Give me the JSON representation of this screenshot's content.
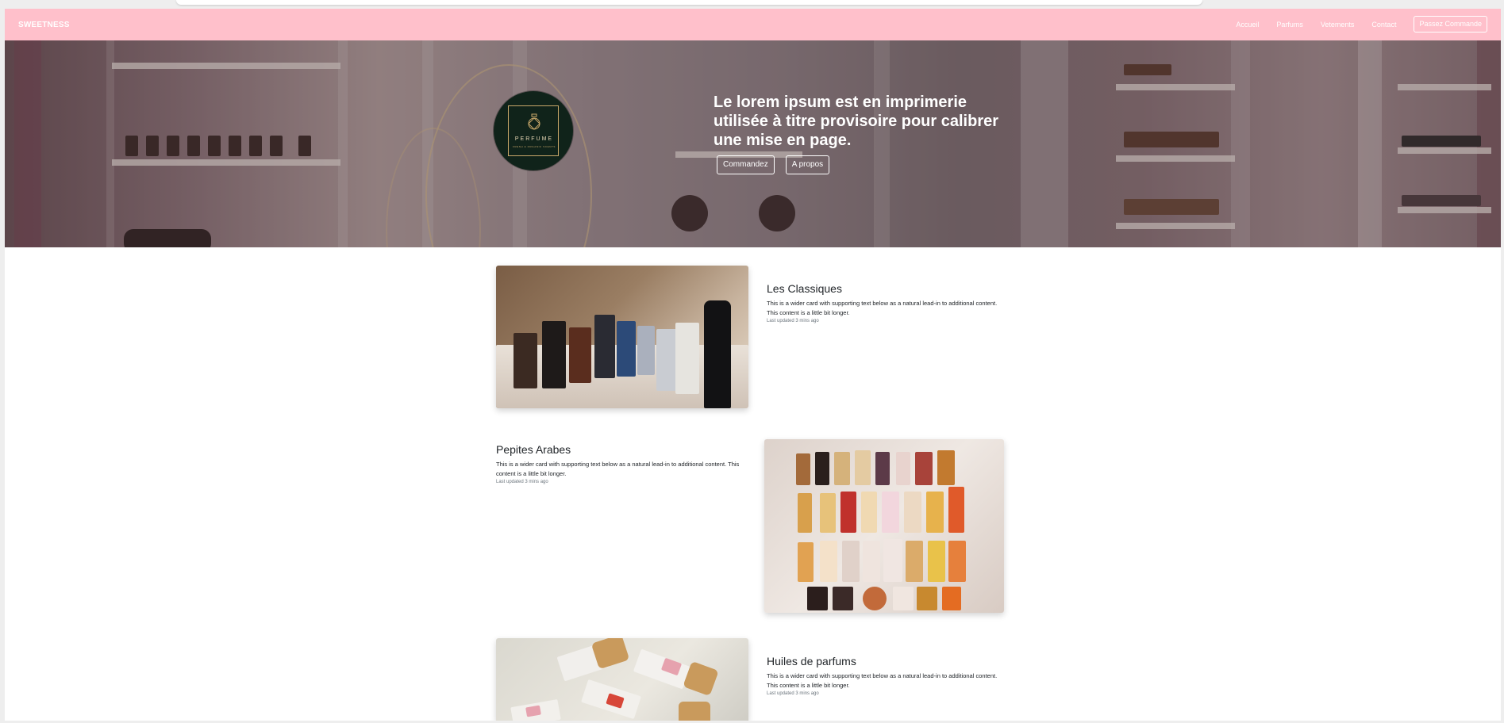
{
  "navbar": {
    "brand": "SWEETNESS",
    "links": [
      "Accueil",
      "Parfums",
      "Vetements",
      "Contact"
    ],
    "cta": "Passez Commande",
    "background": "#ffc0cb"
  },
  "hero": {
    "logo_text": "PERFUME",
    "logo_subtext": "FRESH & ORGANIC SCENTS",
    "heading": "Le lorem ipsum est en imprimerie utilisée à titre provisoire pour calibrer une mise en page.",
    "buttons": [
      "Commandez",
      "A propos"
    ]
  },
  "cards": [
    {
      "title": "Les Classiques",
      "text": "This is a wider card with supporting text below as a natural lead-in to additional content. This content is a little bit longer.",
      "updated": "Last updated 3 mins ago"
    },
    {
      "title": "Pepites Arabes",
      "text": "This is a wider card with supporting text below as a natural lead-in to additional content. This content is a little bit longer.",
      "updated": "Last updated 3 mins ago"
    },
    {
      "title": "Huiles de parfums",
      "text": "This is a wider card with supporting text below as a natural lead-in to additional content. This content is a little bit longer.",
      "updated": "Last updated 3 mins ago"
    }
  ]
}
